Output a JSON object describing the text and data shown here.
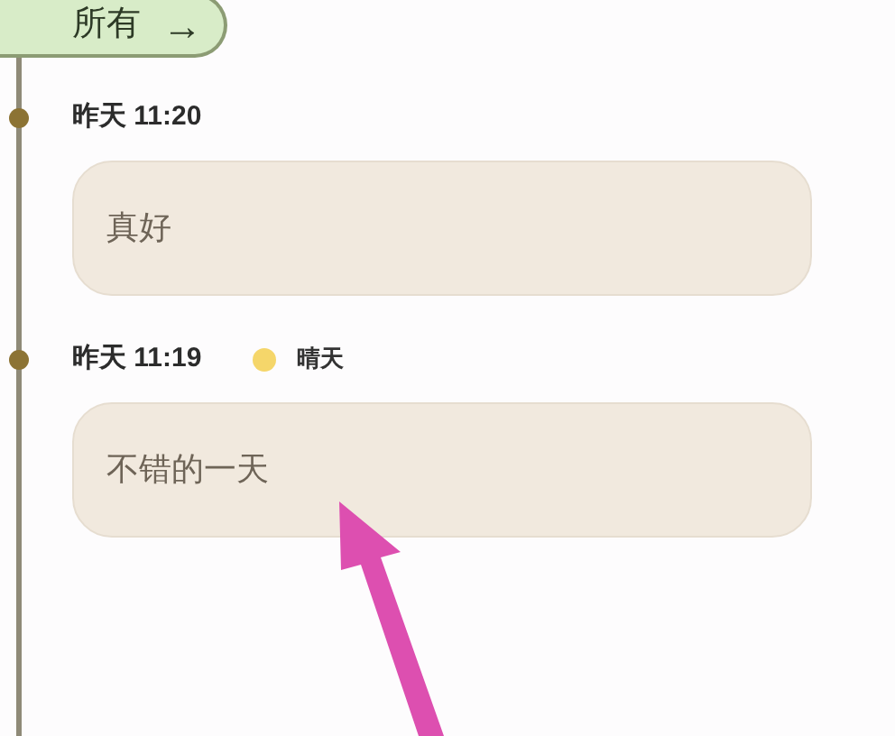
{
  "filter": {
    "label": "所有",
    "icon": "→"
  },
  "entries": [
    {
      "time": "昨天 11:20",
      "text": "真好"
    },
    {
      "time": "昨天 11:19",
      "weather": {
        "label": "晴天",
        "color": "#f5d66a"
      },
      "text": "不错的一天"
    }
  ]
}
